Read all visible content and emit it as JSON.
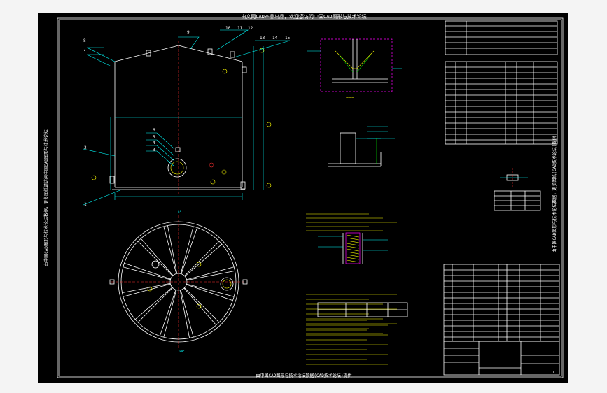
{
  "banner": {
    "top": "由文网CAD产品出品，欢迎您访问中国CAD图形与技术论坛",
    "bottom": "由中国CAD图形与技术论坛数据(CAD技术论坛)提供"
  },
  "side_left": "由中国CAD图形与技术论坛数据，更多图纸请访问中国CAD图形与技术论坛",
  "side_right": "由中国CAD图形与技术论坛数据，更多图纸(CAD技术论坛)提供",
  "callouts": [
    "8",
    "7",
    "9",
    "10",
    "11",
    "12",
    "13",
    "14",
    "15",
    "6",
    "5",
    "4",
    "3",
    "2",
    "1"
  ],
  "title_block": {
    "sheet": "1"
  },
  "colors": {
    "bg": "#000000",
    "outline": "#ffffff",
    "dims": "#00ffff",
    "text": "#ffff00",
    "hatch": "#ff00ff",
    "center": "#ff3030"
  }
}
